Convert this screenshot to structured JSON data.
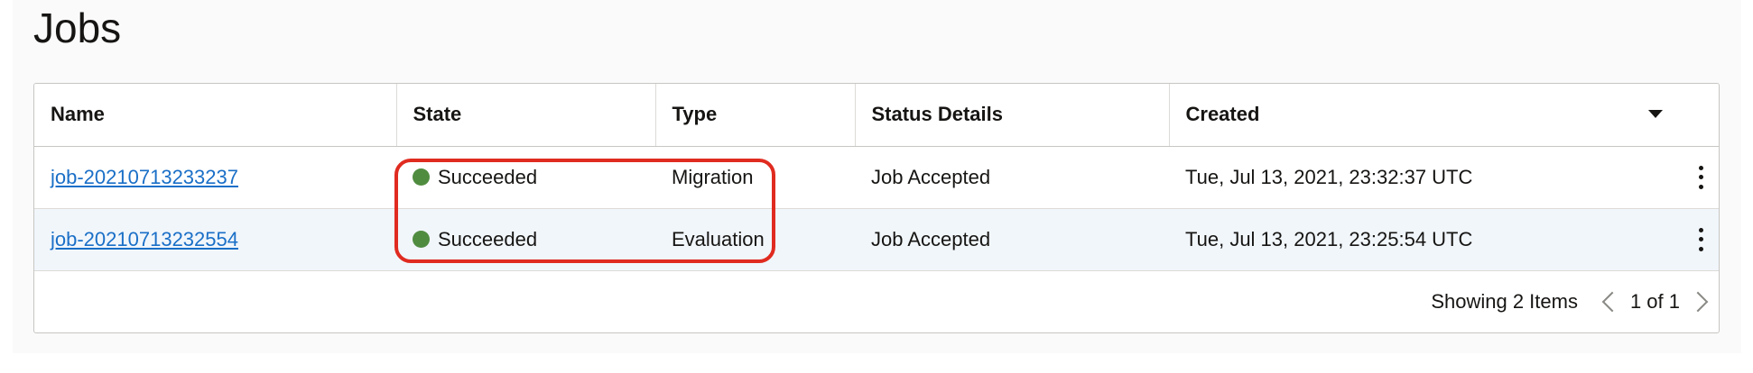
{
  "page": {
    "title": "Jobs"
  },
  "table": {
    "columns": [
      "Name",
      "State",
      "Type",
      "Status Details",
      "Created"
    ],
    "rows": [
      {
        "name": "job-20210713233237",
        "state": "Succeeded",
        "type": "Migration",
        "status_details": "Job Accepted",
        "created": "Tue, Jul 13, 2021, 23:32:37 UTC"
      },
      {
        "name": "job-20210713232554",
        "state": "Succeeded",
        "type": "Evaluation",
        "status_details": "Job Accepted",
        "created": "Tue, Jul 13, 2021, 23:25:54 UTC"
      }
    ],
    "footer": {
      "showing": "Showing 2 Items",
      "pagination": "1 of 1"
    }
  },
  "icons": {
    "sort": "caret-down-icon",
    "row_actions": "kebab-menu-icon",
    "prev": "chevron-left-icon",
    "next": "chevron-right-icon"
  },
  "colors": {
    "link": "#1a6fc7",
    "succeeded": "#508c40",
    "highlight": "#e02b20",
    "alt_row": "#f1f6fb"
  }
}
